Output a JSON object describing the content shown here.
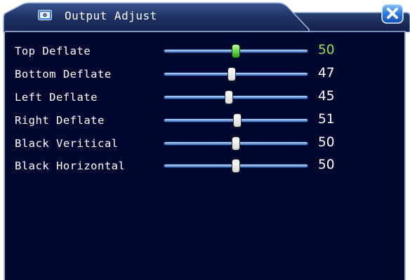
{
  "dialog": {
    "title": "Output Adjust"
  },
  "settings": [
    {
      "label": "Top Deflate",
      "value": "50",
      "level": 0.5,
      "active": true
    },
    {
      "label": "Bottom Deflate",
      "value": "47",
      "level": 0.47,
      "active": false
    },
    {
      "label": "Left Deflate",
      "value": "45",
      "level": 0.45,
      "active": false
    },
    {
      "label": "Right Deflate",
      "value": "51",
      "level": 0.51,
      "active": false
    },
    {
      "label": "Black Veritical",
      "value": "50",
      "level": 0.5,
      "active": false
    },
    {
      "label": "Black Horizontal",
      "value": "50",
      "level": 0.5,
      "active": false
    }
  ],
  "colors": {
    "panel_background": "#01082f",
    "title_bar": "#1c2e5c",
    "active_value": "#8fe35a",
    "close_button": "#2f7fe0"
  },
  "icons": {
    "title": "settings-window-icon",
    "close": "close-icon"
  }
}
